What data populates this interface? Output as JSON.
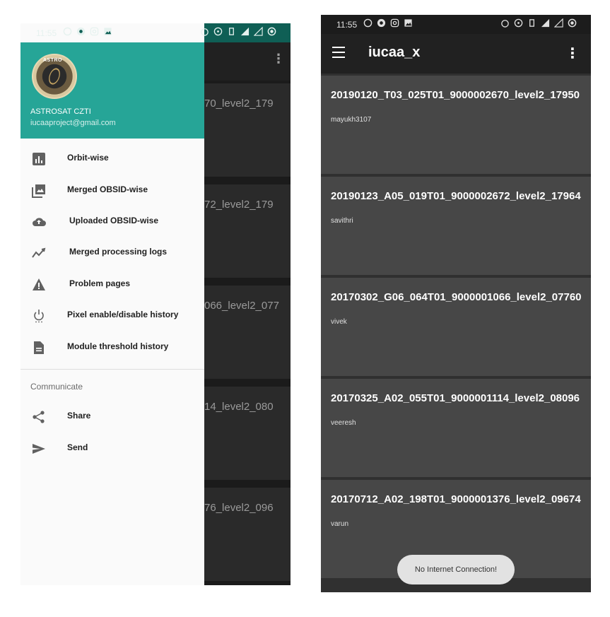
{
  "status_bar": {
    "time": "11:55"
  },
  "drawer": {
    "avatar_text": "ASTRO",
    "account_name": "ASTROSAT CZTI",
    "account_email": "iucaaproject@gmail.com",
    "items": [
      {
        "label": "Orbit-wise",
        "icon": "bar-chart-icon"
      },
      {
        "label": "Merged OBSID-wise",
        "icon": "photo-library-icon"
      },
      {
        "label": "Uploaded OBSID-wise",
        "icon": "cloud-upload-icon"
      },
      {
        "label": "Merged processing logs",
        "icon": "trending-icon"
      },
      {
        "label": "Problem pages",
        "icon": "warning-icon"
      },
      {
        "label": "Pixel enable/disable history",
        "icon": "power-settings-icon"
      },
      {
        "label": "Module threshold history",
        "icon": "document-icon"
      }
    ],
    "section_label": "Communicate",
    "communicate_items": [
      {
        "label": "Share",
        "icon": "share-icon"
      },
      {
        "label": "Send",
        "icon": "send-icon"
      }
    ]
  },
  "background_partial_titles": [
    "70_level2_179",
    "72_level2_179",
    "066_level2_077",
    "14_level2_080",
    "76_level2_096"
  ],
  "app": {
    "title": "iucaa_x",
    "cards": [
      {
        "title": "20190120_T03_025T01_9000002670_level2_17950",
        "user": "mayukh3107"
      },
      {
        "title": "20190123_A05_019T01_9000002672_level2_17964",
        "user": "savithri"
      },
      {
        "title": "20170302_G06_064T01_9000001066_level2_07760",
        "user": "vivek"
      },
      {
        "title": "20170325_A02_055T01_9000001114_level2_08096",
        "user": "veeresh"
      },
      {
        "title": "20170712_A02_198T01_9000001376_level2_09674",
        "user": "varun"
      }
    ],
    "toast": "No Internet Connection!"
  }
}
